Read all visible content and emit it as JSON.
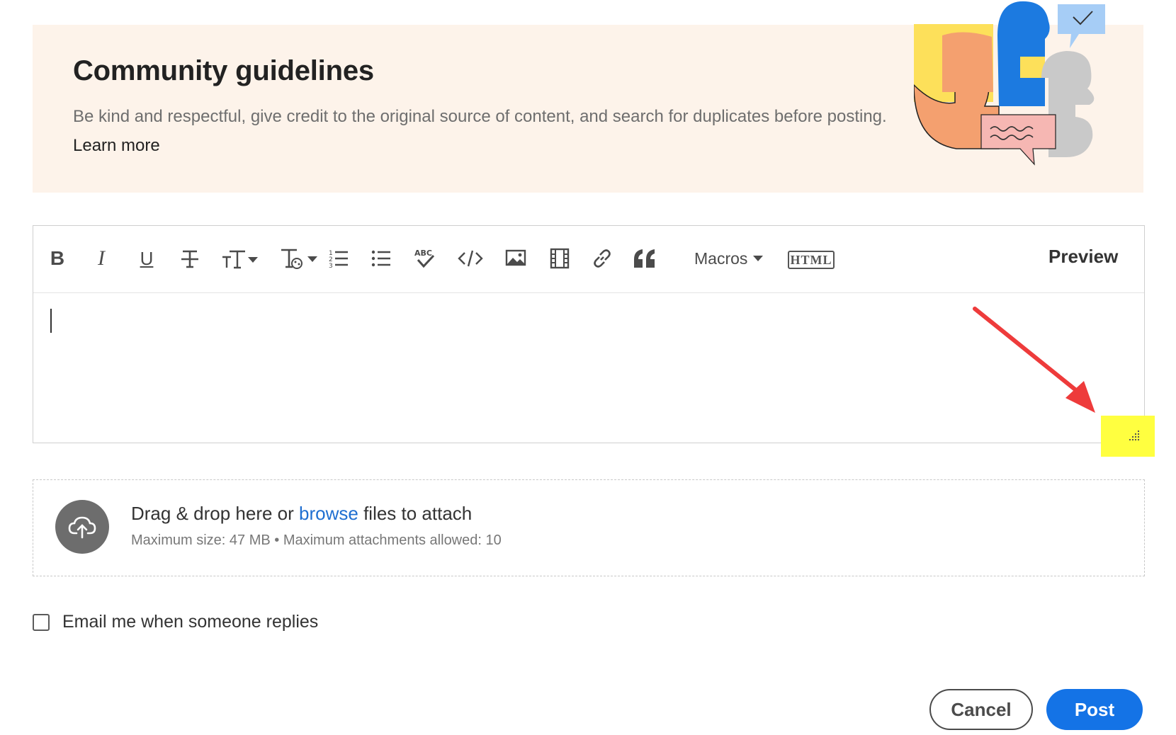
{
  "guidelines": {
    "title": "Community guidelines",
    "text": "Be kind and respectful, give credit to the original source of content, and search for duplicates before posting.",
    "link_label": "Learn more",
    "background_color": "#fdf3ea"
  },
  "editor": {
    "toolbar": {
      "bold_label": "B",
      "italic_label": "I",
      "underline_label": "U",
      "items": [
        "bold-icon",
        "italic-icon",
        "underline-icon",
        "strikethrough-icon",
        "font-size-icon",
        "text-style-icon",
        "ordered-list-icon",
        "unordered-list-icon",
        "spellcheck-icon",
        "code-icon",
        "image-icon",
        "video-icon",
        "link-icon",
        "quote-icon"
      ],
      "macros_label": "Macros",
      "html_label": "HTML",
      "preview_label": "Preview"
    },
    "body_text": "",
    "annotation_colors": {
      "arrow": "#ee3b3b",
      "highlight": "#ffff40"
    }
  },
  "attachments": {
    "drop_text_before": "Drag & drop here or ",
    "browse_label": "browse",
    "drop_text_after": " files to attach",
    "limits_text": "Maximum size: 47 MB • Maximum attachments allowed: 10"
  },
  "email_option": {
    "label": "Email me when someone replies",
    "checked": false
  },
  "actions": {
    "cancel_label": "Cancel",
    "post_label": "Post",
    "post_color": "#1473e6"
  }
}
